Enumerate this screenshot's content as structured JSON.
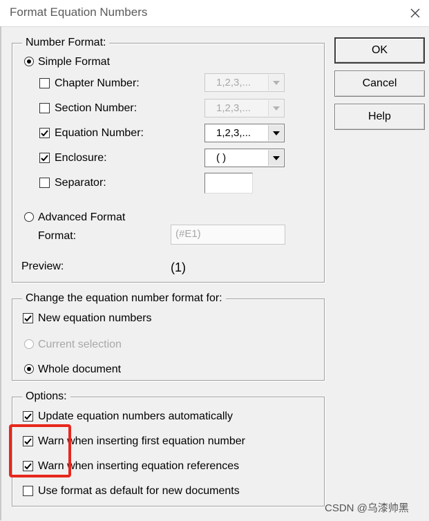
{
  "window": {
    "title": "Format Equation Numbers"
  },
  "number_format": {
    "legend": "Number Format:",
    "simple_format": {
      "label": "Simple Format",
      "selected": true
    },
    "chapter_number": {
      "label": "Chapter Number:",
      "checked": false,
      "value": "1,2,3,...",
      "enabled": false
    },
    "section_number": {
      "label": "Section Number:",
      "checked": false,
      "value": "1,2,3,...",
      "enabled": false
    },
    "equation_number": {
      "label": "Equation Number:",
      "checked": true,
      "value": "1,2,3,...",
      "enabled": true
    },
    "enclosure": {
      "label": "Enclosure:",
      "checked": true,
      "value": "( )",
      "enabled": true
    },
    "separator": {
      "label": "Separator:",
      "checked": false,
      "value": ""
    },
    "advanced_format": {
      "label": "Advanced Format",
      "selected": false
    },
    "format": {
      "label": "Format:",
      "value": "(#E1)"
    },
    "preview": {
      "label": "Preview:",
      "value": "(1)"
    }
  },
  "change_for": {
    "legend": "Change the equation number format for:",
    "new_equation_numbers": {
      "label": "New equation numbers",
      "checked": true
    },
    "current_selection": {
      "label": "Current selection",
      "selected": false,
      "enabled": false
    },
    "whole_document": {
      "label": "Whole document",
      "selected": true
    }
  },
  "options": {
    "legend": "Options:",
    "update_automatically": {
      "label": "Update equation numbers automatically",
      "checked": true
    },
    "warn_first": {
      "label": "Warn when inserting first equation number",
      "checked": true
    },
    "warn_references": {
      "label": "Warn when inserting equation references",
      "checked": true
    },
    "use_default": {
      "label": "Use format as default for new documents",
      "checked": false
    }
  },
  "buttons": {
    "ok": "OK",
    "cancel": "Cancel",
    "help": "Help"
  },
  "watermark": "CSDN @乌漆帅黑",
  "colors": {
    "highlight": "#e8271c"
  }
}
